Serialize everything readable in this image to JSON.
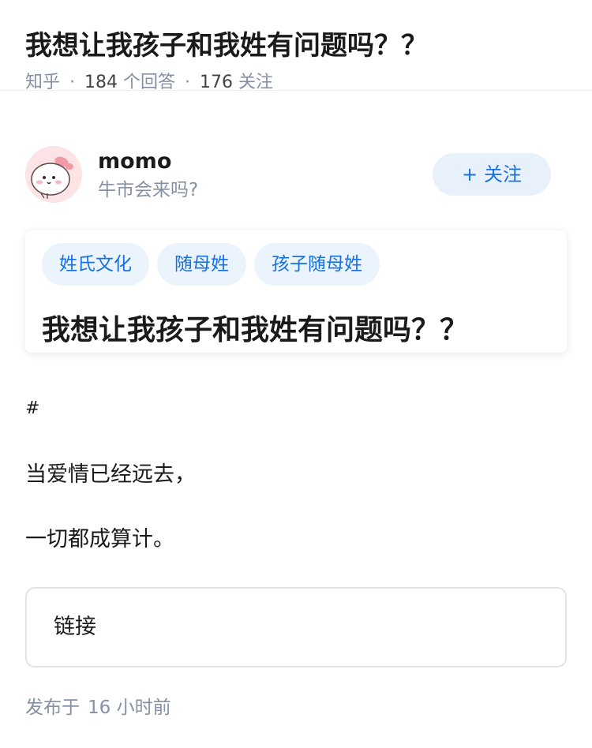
{
  "question": {
    "title": "我想让我孩子和我姓有问题吗？？",
    "source": "知乎",
    "answers_count": "184",
    "answers_label": "个回答",
    "followers_count": "176",
    "followers_label": "关注",
    "separator": "·"
  },
  "author": {
    "name": "momo",
    "bio": "牛市会来吗?",
    "avatar_icon": "cute-bunny-avatar",
    "follow_plus": "+",
    "follow_label": "关注"
  },
  "card": {
    "tags": [
      "姓氏文化",
      "随母姓",
      "孩子随母姓"
    ],
    "title": "我想让我孩子和我姓有问题吗？？"
  },
  "content": {
    "heading": "#",
    "line1": "当爱情已经远去，",
    "line2": "一切都成算计。"
  },
  "link": {
    "label": "链接"
  },
  "footer": {
    "published_label": "发布于",
    "published_num": "16",
    "published_unit": "小时前"
  },
  "colors": {
    "accent": "#1772e0",
    "tag_bg": "#ebf3fd",
    "muted_text": "#8590a6",
    "avatar_bg": "#fbe3e6"
  }
}
